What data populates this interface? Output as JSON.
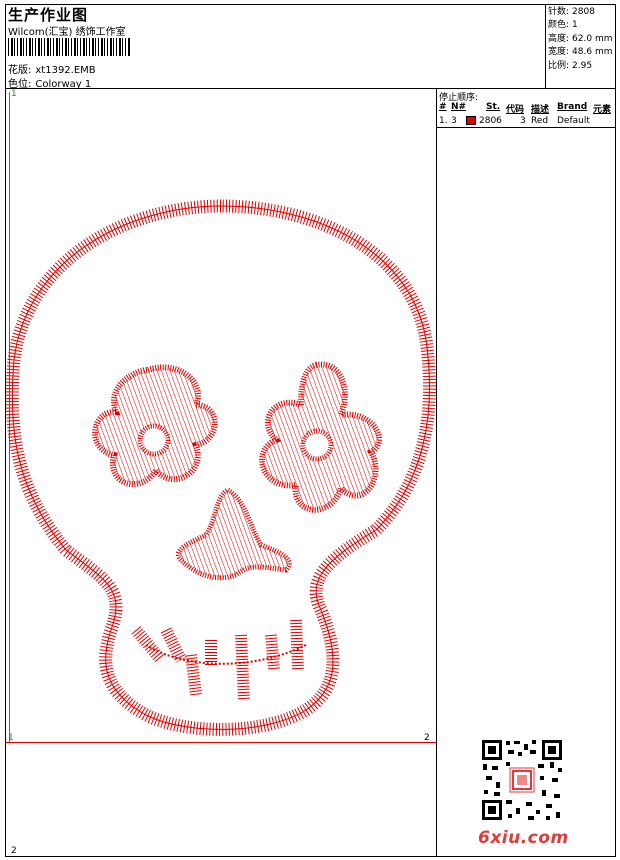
{
  "header": {
    "title": "生产作业图",
    "subtitle": "Wilcom(汇宝) 绣饰工作室",
    "design_label": "花版:",
    "design_value": "xt1392.EMB",
    "colorway_label": "色位:",
    "colorway_value": "Colorway 1"
  },
  "stats": [
    {
      "label": "针数:",
      "value": "2808"
    },
    {
      "label": "颜色:",
      "value": "1"
    },
    {
      "label": "高度:",
      "value": "62.0 mm"
    },
    {
      "label": "宽度:",
      "value": "48.6 mm"
    },
    {
      "label": "比例:",
      "value": "2.95"
    }
  ],
  "stop_sequence": {
    "title": "停止顺序:",
    "columns": [
      "#",
      "N#",
      "St.",
      "代码",
      "描述",
      "Brand",
      "元素"
    ],
    "rows": [
      {
        "num": "1.",
        "needle": "3",
        "color": "#e00000",
        "stitches": "2806",
        "code": "3",
        "desc": "Red",
        "brand": "Default",
        "element": ""
      }
    ]
  },
  "markers": {
    "top_left": "1",
    "mid_left": "1",
    "mid_right": "2",
    "bottom_left": "2"
  },
  "colors": {
    "thread": "#e00000",
    "marker_green": "#00aa00"
  },
  "watermark": {
    "site": "6xiu.com"
  }
}
